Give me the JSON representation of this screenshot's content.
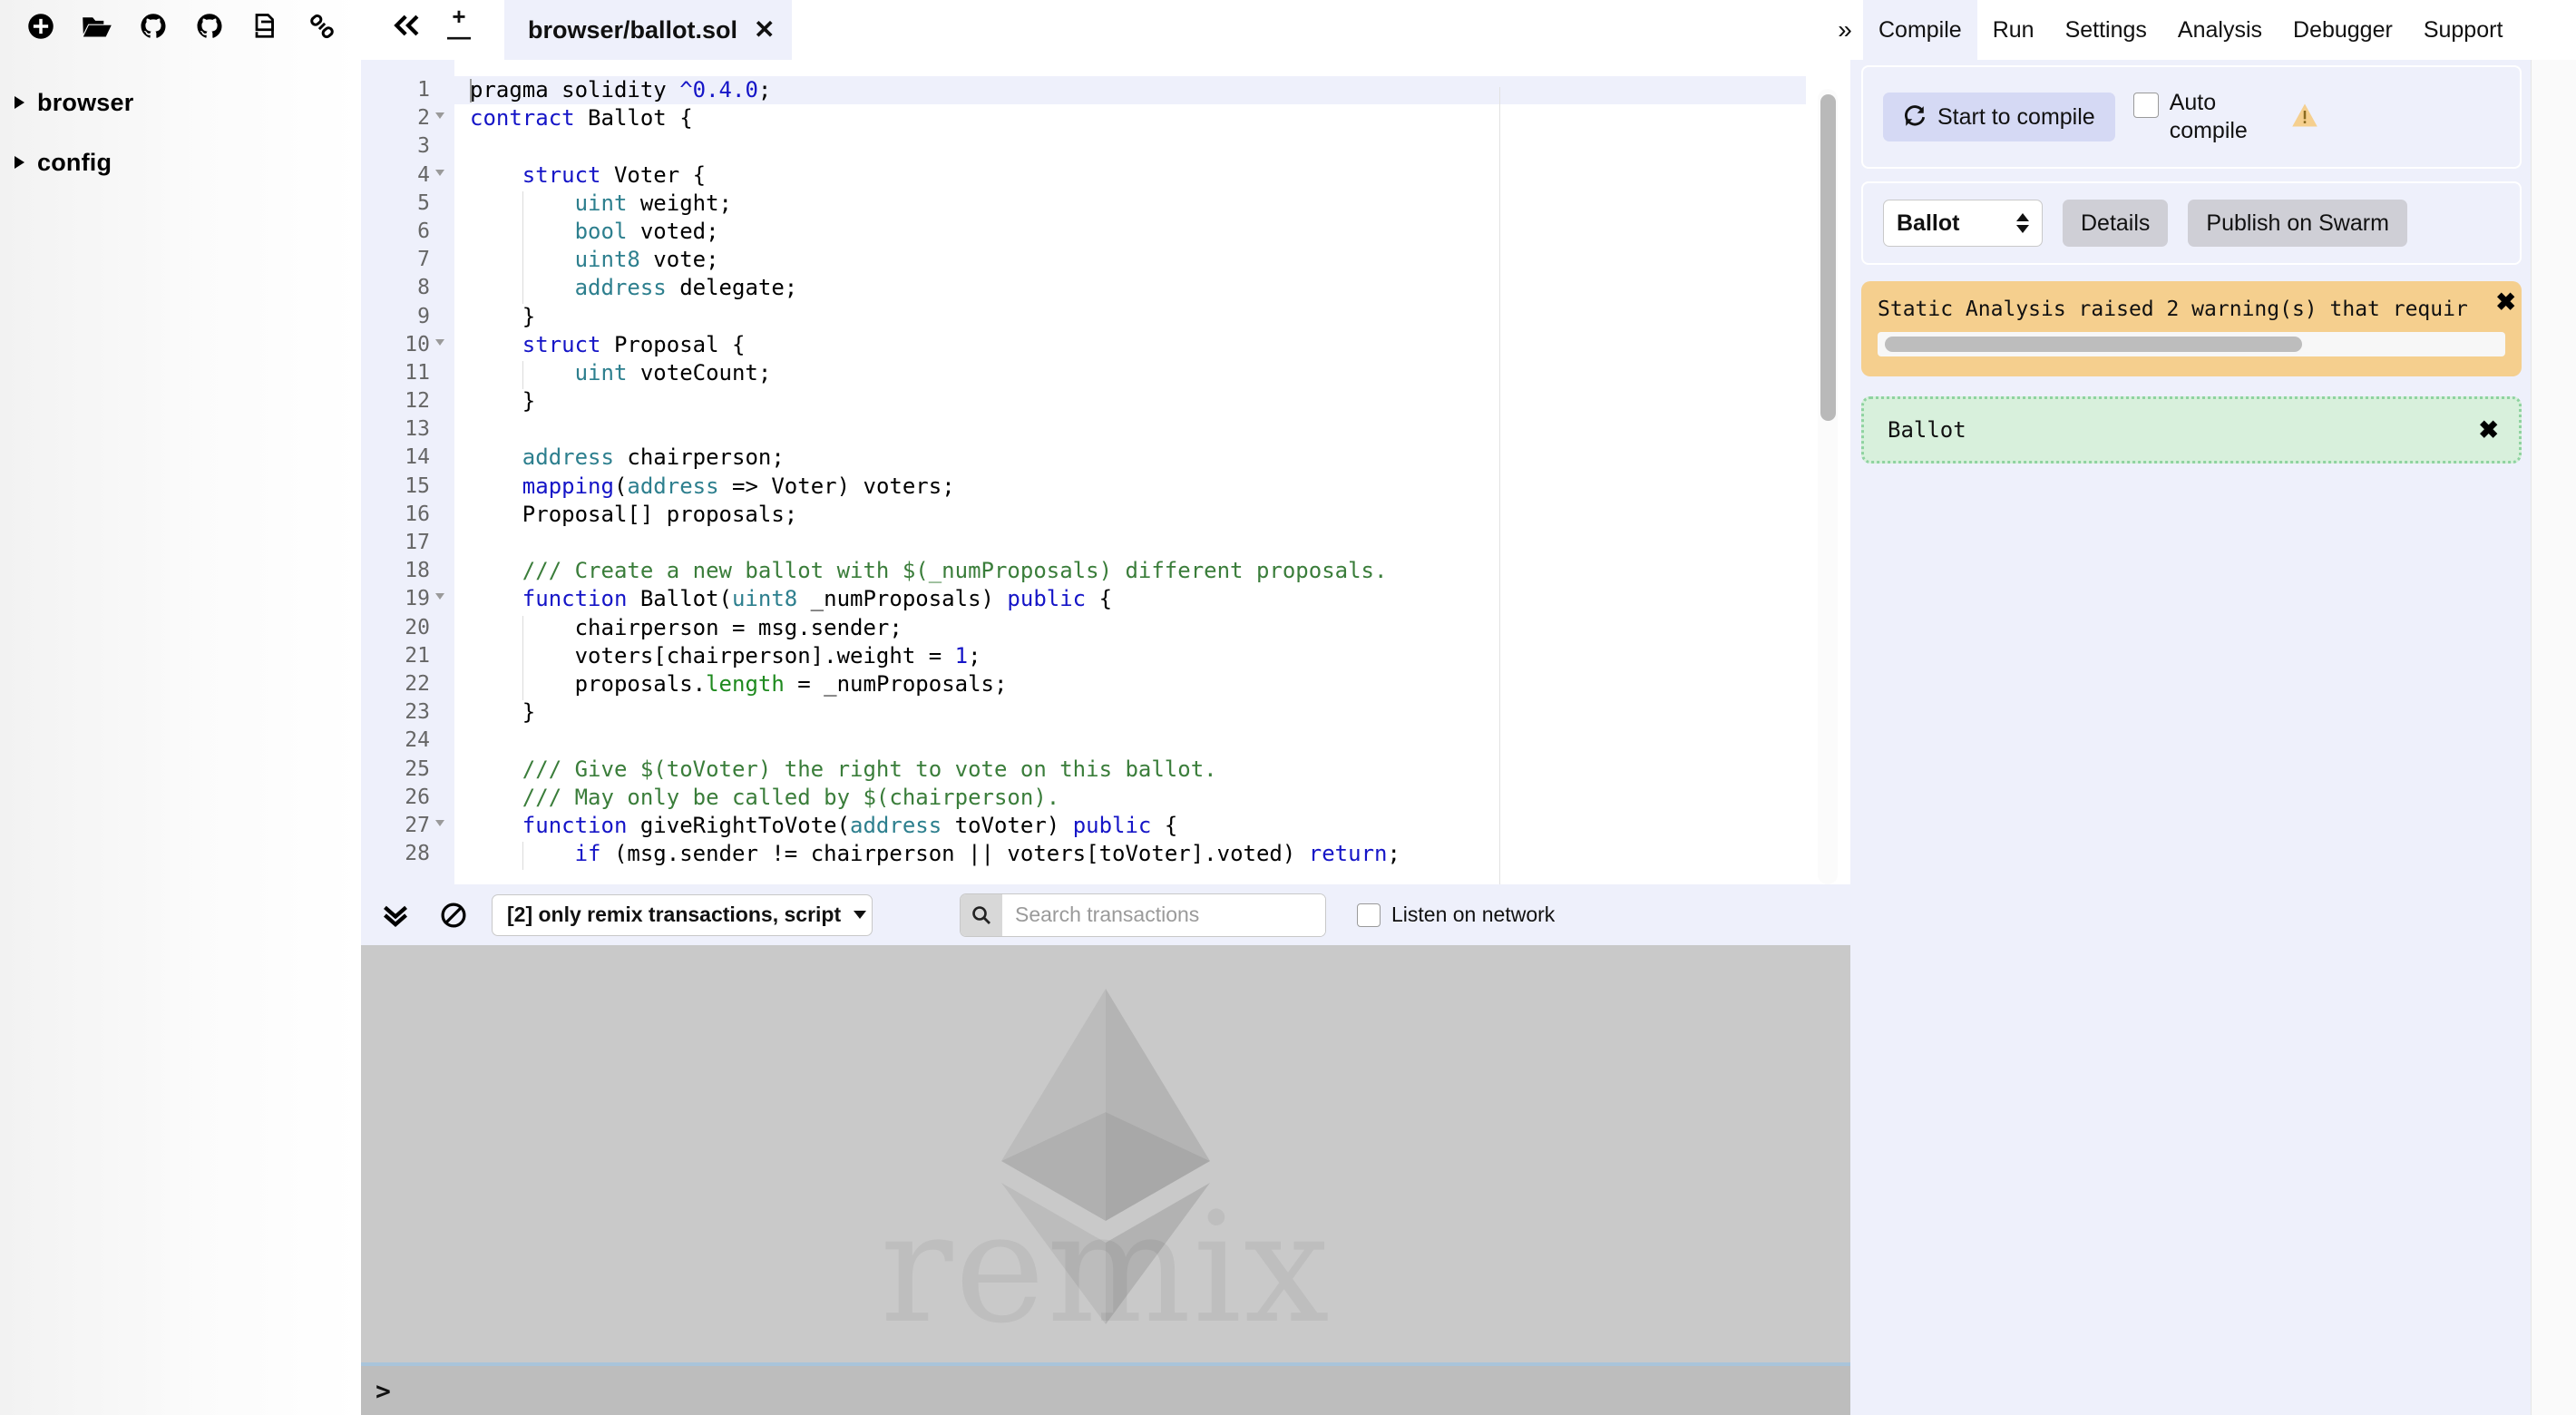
{
  "filepanel": {
    "toolbar_icons": [
      {
        "name": "create-file-icon",
        "title": "Create new file"
      },
      {
        "name": "open-folder-icon",
        "title": "Open folder"
      },
      {
        "name": "github-import-icon",
        "title": "Import from GitHub"
      },
      {
        "name": "github-publish-icon",
        "title": "Publish to GitHub"
      },
      {
        "name": "copy-files-icon",
        "title": "Copy files"
      },
      {
        "name": "link-icon",
        "title": "Share link"
      }
    ],
    "tree": [
      {
        "label": "browser",
        "expanded": false
      },
      {
        "label": "config",
        "expanded": false
      }
    ]
  },
  "tabbar": {
    "collapse_icon": "chevron-double-left-icon",
    "zoom_in": "+",
    "zoom_out": "—",
    "tabs": [
      {
        "title": "browser/ballot.sol",
        "active": true,
        "close": "✕"
      }
    ]
  },
  "editor": {
    "language": "solidity",
    "active_line": 1,
    "lines": [
      {
        "n": "1",
        "fold": false,
        "indent_guides": 0,
        "tokens": [
          {
            "t": "pragma solidity ",
            "c": ""
          },
          {
            "t": "^",
            "c": "k"
          },
          {
            "t": "0.4.0",
            "c": "n"
          },
          {
            "t": ";",
            "c": ""
          }
        ]
      },
      {
        "n": "2",
        "fold": true,
        "indent_guides": 0,
        "tokens": [
          {
            "t": "contract",
            "c": "k"
          },
          {
            "t": " Ballot {",
            "c": ""
          }
        ]
      },
      {
        "n": "3",
        "fold": false,
        "indent_guides": 0,
        "tokens": []
      },
      {
        "n": "4",
        "fold": true,
        "indent_guides": 0,
        "tokens": [
          {
            "t": "    ",
            "c": ""
          },
          {
            "t": "struct",
            "c": "k"
          },
          {
            "t": " Voter {",
            "c": ""
          }
        ]
      },
      {
        "n": "5",
        "fold": false,
        "indent_guides": 1,
        "tokens": [
          {
            "t": "        ",
            "c": ""
          },
          {
            "t": "uint",
            "c": "t"
          },
          {
            "t": " weight;",
            "c": ""
          }
        ]
      },
      {
        "n": "6",
        "fold": false,
        "indent_guides": 1,
        "tokens": [
          {
            "t": "        ",
            "c": ""
          },
          {
            "t": "bool",
            "c": "t"
          },
          {
            "t": " voted;",
            "c": ""
          }
        ]
      },
      {
        "n": "7",
        "fold": false,
        "indent_guides": 1,
        "tokens": [
          {
            "t": "        ",
            "c": ""
          },
          {
            "t": "uint8",
            "c": "t"
          },
          {
            "t": " vote;",
            "c": ""
          }
        ]
      },
      {
        "n": "8",
        "fold": false,
        "indent_guides": 1,
        "tokens": [
          {
            "t": "        ",
            "c": ""
          },
          {
            "t": "address",
            "c": "t"
          },
          {
            "t": " delegate;",
            "c": ""
          }
        ]
      },
      {
        "n": "9",
        "fold": false,
        "indent_guides": 0,
        "tokens": [
          {
            "t": "    }",
            "c": ""
          }
        ]
      },
      {
        "n": "10",
        "fold": true,
        "indent_guides": 0,
        "tokens": [
          {
            "t": "    ",
            "c": ""
          },
          {
            "t": "struct",
            "c": "k"
          },
          {
            "t": " Proposal {",
            "c": ""
          }
        ]
      },
      {
        "n": "11",
        "fold": false,
        "indent_guides": 1,
        "tokens": [
          {
            "t": "        ",
            "c": ""
          },
          {
            "t": "uint",
            "c": "t"
          },
          {
            "t": " voteCount;",
            "c": ""
          }
        ]
      },
      {
        "n": "12",
        "fold": false,
        "indent_guides": 0,
        "tokens": [
          {
            "t": "    }",
            "c": ""
          }
        ]
      },
      {
        "n": "13",
        "fold": false,
        "indent_guides": 0,
        "tokens": []
      },
      {
        "n": "14",
        "fold": false,
        "indent_guides": 0,
        "tokens": [
          {
            "t": "    ",
            "c": ""
          },
          {
            "t": "address",
            "c": "t"
          },
          {
            "t": " chairperson;",
            "c": ""
          }
        ]
      },
      {
        "n": "15",
        "fold": false,
        "indent_guides": 0,
        "tokens": [
          {
            "t": "    ",
            "c": ""
          },
          {
            "t": "mapping",
            "c": "k"
          },
          {
            "t": "(",
            "c": ""
          },
          {
            "t": "address",
            "c": "t"
          },
          {
            "t": " => Voter) voters;",
            "c": ""
          }
        ]
      },
      {
        "n": "16",
        "fold": false,
        "indent_guides": 0,
        "tokens": [
          {
            "t": "    Proposal[] proposals;",
            "c": ""
          }
        ]
      },
      {
        "n": "17",
        "fold": false,
        "indent_guides": 0,
        "tokens": []
      },
      {
        "n": "18",
        "fold": false,
        "indent_guides": 0,
        "tokens": [
          {
            "t": "    ",
            "c": ""
          },
          {
            "t": "/// Create a new ballot with $(_numProposals) different proposals.",
            "c": "c"
          }
        ]
      },
      {
        "n": "19",
        "fold": true,
        "indent_guides": 0,
        "tokens": [
          {
            "t": "    ",
            "c": ""
          },
          {
            "t": "function",
            "c": "k"
          },
          {
            "t": " Ballot(",
            "c": ""
          },
          {
            "t": "uint8",
            "c": "t"
          },
          {
            "t": " _numProposals) ",
            "c": ""
          },
          {
            "t": "public",
            "c": "k"
          },
          {
            "t": " {",
            "c": ""
          }
        ]
      },
      {
        "n": "20",
        "fold": false,
        "indent_guides": 1,
        "tokens": [
          {
            "t": "        chairperson = msg.sender;",
            "c": ""
          }
        ]
      },
      {
        "n": "21",
        "fold": false,
        "indent_guides": 1,
        "tokens": [
          {
            "t": "        voters[chairperson].weight = ",
            "c": ""
          },
          {
            "t": "1",
            "c": "n"
          },
          {
            "t": ";",
            "c": ""
          }
        ]
      },
      {
        "n": "22",
        "fold": false,
        "indent_guides": 1,
        "tokens": [
          {
            "t": "        proposals.",
            "c": ""
          },
          {
            "t": "length",
            "c": "p"
          },
          {
            "t": " = _numProposals;",
            "c": ""
          }
        ]
      },
      {
        "n": "23",
        "fold": false,
        "indent_guides": 0,
        "tokens": [
          {
            "t": "    }",
            "c": ""
          }
        ]
      },
      {
        "n": "24",
        "fold": false,
        "indent_guides": 0,
        "tokens": []
      },
      {
        "n": "25",
        "fold": false,
        "indent_guides": 0,
        "tokens": [
          {
            "t": "    ",
            "c": ""
          },
          {
            "t": "/// Give $(toVoter) the right to vote on this ballot.",
            "c": "c"
          }
        ]
      },
      {
        "n": "26",
        "fold": false,
        "indent_guides": 0,
        "tokens": [
          {
            "t": "    ",
            "c": ""
          },
          {
            "t": "/// May only be called by $(chairperson).",
            "c": "c"
          }
        ]
      },
      {
        "n": "27",
        "fold": true,
        "indent_guides": 0,
        "tokens": [
          {
            "t": "    ",
            "c": ""
          },
          {
            "t": "function",
            "c": "k"
          },
          {
            "t": " giveRightToVote(",
            "c": ""
          },
          {
            "t": "address",
            "c": "t"
          },
          {
            "t": " toVoter) ",
            "c": ""
          },
          {
            "t": "public",
            "c": "k"
          },
          {
            "t": " {",
            "c": ""
          }
        ]
      },
      {
        "n": "28",
        "fold": false,
        "indent_guides": 1,
        "tokens": [
          {
            "t": "        ",
            "c": ""
          },
          {
            "t": "if",
            "c": "k"
          },
          {
            "t": " (msg.sender != chairperson || voters[toVoter].voted) ",
            "c": ""
          },
          {
            "t": "return",
            "c": "k"
          },
          {
            "t": ";",
            "c": ""
          }
        ]
      }
    ]
  },
  "terminal": {
    "toolbar": {
      "collapse_icon": "chevron-double-down-icon",
      "clear_icon": "ban-icon",
      "filter_label": "[2] only remix transactions, script",
      "search_placeholder": "Search transactions",
      "search_value": "",
      "search_icon": "search-icon",
      "listen_label": "Listen on network",
      "listen_checked": false
    },
    "watermark": "remix",
    "logo": "ethereum-logo",
    "prompt": ">"
  },
  "nav": {
    "chevron": "»",
    "items": [
      {
        "label": "Compile",
        "active": true
      },
      {
        "label": "Run",
        "active": false
      },
      {
        "label": "Settings",
        "active": false
      },
      {
        "label": "Analysis",
        "active": false
      },
      {
        "label": "Debugger",
        "active": false
      },
      {
        "label": "Support",
        "active": false
      }
    ]
  },
  "compile_panel": {
    "start_button": "Start to compile",
    "start_icon": "refresh-icon",
    "auto_compile_label": "Auto compile",
    "auto_compile_checked": false,
    "warning_icon": "warning-triangle-icon",
    "contract_select_value": "Ballot",
    "details_button": "Details",
    "publish_button": "Publish on Swarm",
    "alerts": [
      {
        "type": "warning",
        "text": "Static Analysis raised 2 warning(s) that requir",
        "close": "✖",
        "has_scrollbar": true
      },
      {
        "type": "success",
        "text": "Ballot",
        "close": "✖",
        "has_scrollbar": false
      }
    ]
  },
  "colors": {
    "panel_bg": "#eef0fb",
    "accent_button": "#d5d9f4",
    "warning_bg": "#f5cf8e",
    "success_bg": "#d8f0dc",
    "success_border": "#8fd3a0",
    "terminal_bg": "#c9c9c9",
    "keyword": "#1515c7",
    "type": "#2d7f8e",
    "comment": "#3a7d3a"
  }
}
